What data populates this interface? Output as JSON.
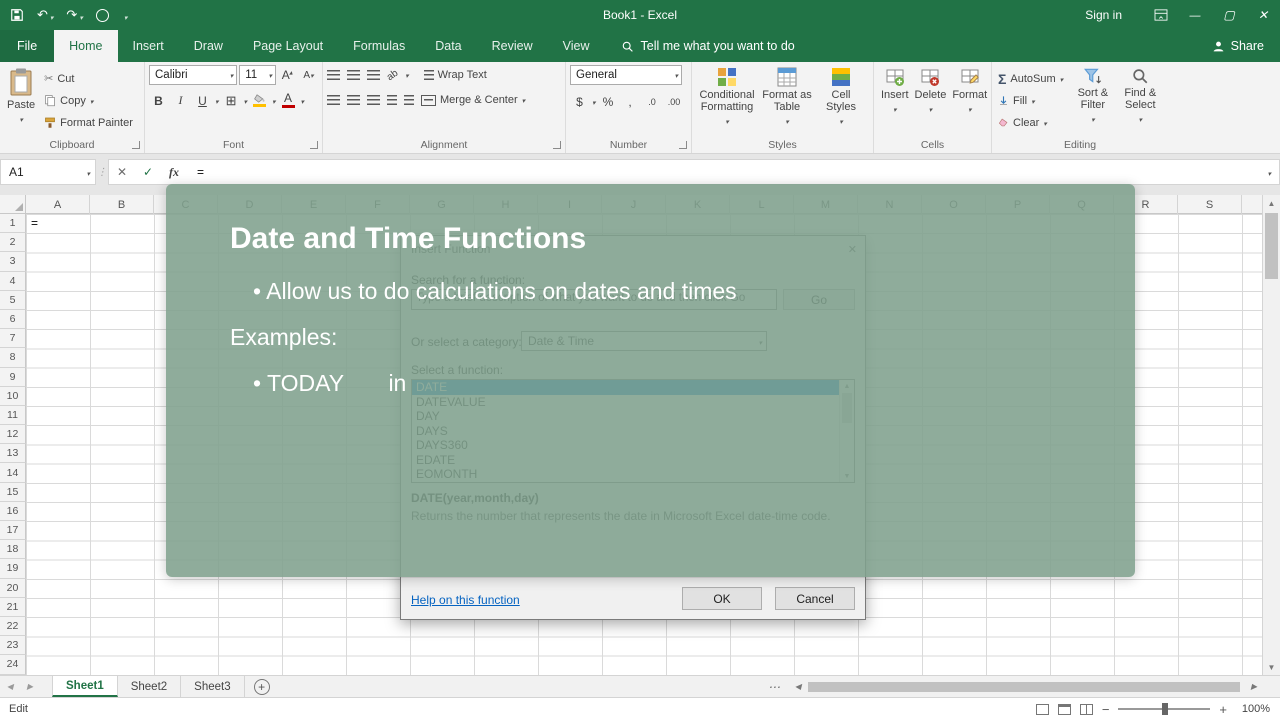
{
  "titlebar": {
    "title": "Book1 - Excel",
    "sign_in": "Sign in"
  },
  "tabs": {
    "file": "File",
    "active": "Home",
    "others": [
      "Insert",
      "Draw",
      "Page Layout",
      "Formulas",
      "Data",
      "Review",
      "View"
    ],
    "tell_me": "Tell me what you want to do",
    "share": "Share"
  },
  "ribbon": {
    "clipboard": {
      "label": "Clipboard",
      "paste": "Paste",
      "cut": "Cut",
      "copy": "Copy",
      "format_painter": "Format Painter"
    },
    "font": {
      "label": "Font",
      "name": "Calibri",
      "size": "11",
      "bold": "B",
      "italic": "I",
      "underline": "U",
      "grow": "A",
      "shrink": "A",
      "color_a": "A"
    },
    "alignment": {
      "label": "Alignment",
      "wrap_text": "Wrap Text",
      "merge_center": "Merge & Center"
    },
    "number": {
      "label": "Number",
      "format": "General",
      "currency": "$",
      "percent": "%",
      "comma": ",",
      "inc_decimal": ".0",
      "dec_decimal": ".00"
    },
    "styles": {
      "label": "Styles",
      "conditional": "Conditional Formatting",
      "format_table": "Format as Table",
      "cell_styles": "Cell Styles"
    },
    "cells": {
      "label": "Cells",
      "insert": "Insert",
      "delete": "Delete",
      "format": "Format"
    },
    "editing": {
      "label": "Editing",
      "sigma": "Σ",
      "autosum": "AutoSum",
      "fill": "Fill",
      "clear": "Clear",
      "sort_filter": "Sort & Filter",
      "find_select": "Find & Select"
    }
  },
  "formula_bar": {
    "name_box": "A1",
    "cancel": "✕",
    "enter": "✓",
    "fx": "fx",
    "formula": "="
  },
  "grid": {
    "columns": [
      "A",
      "B",
      "C",
      "D",
      "E",
      "F",
      "G",
      "H",
      "I",
      "J",
      "K",
      "L",
      "M",
      "N",
      "O",
      "P",
      "Q",
      "R",
      "S"
    ],
    "rows": [
      "1",
      "2",
      "3",
      "4",
      "5",
      "6",
      "7",
      "8",
      "9",
      "10",
      "11",
      "12",
      "13",
      "14",
      "15",
      "16",
      "17",
      "18",
      "19",
      "20",
      "21",
      "22",
      "23",
      "24"
    ],
    "active_cell_value": "="
  },
  "overlay": {
    "title": "Date and Time Functions",
    "bullet1": "• Allow us to do calculations on dates and times",
    "examples": "Examples:",
    "bullet2": "• TODAY       in"
  },
  "dialog": {
    "title": "Insert Function",
    "search_label": "Search for a function:",
    "search_hint": "Type a brief description of what you want to do and then click Go",
    "go": "Go",
    "category_label": "Or select a category:",
    "category_value": "Date & Time",
    "select_label": "Select a function:",
    "selected_function": "DATE",
    "functions": [
      "DATEVALUE",
      "DAY",
      "DAYS",
      "DAYS360",
      "EDATE",
      "EOMONTH"
    ],
    "signature": "DATE(year,month,day)",
    "description": "Returns the number that represents the date in Microsoft Excel date-time code.",
    "help_link": "Help on this function",
    "ok": "OK",
    "cancel": "Cancel"
  },
  "sheets": {
    "active": "Sheet1",
    "others": [
      "Sheet2",
      "Sheet3"
    ]
  },
  "status": {
    "mode": "Edit",
    "zoom": "100%"
  },
  "colors": {
    "excel_green": "#217346",
    "selection_blue": "#0078d7",
    "overlay_green": "rgba(127,160,141,0.88)"
  },
  "icons": {
    "save": "disk",
    "undo": "↶",
    "redo": "↷",
    "caret-down": "▾",
    "minimize": "—",
    "maximize": "▢",
    "close": "✕",
    "search": "magnifier",
    "person": "silhouette",
    "scissors": "✂",
    "sheet-left": "◀",
    "sheet-right": "▶",
    "scroll-up": "▲",
    "scroll-down": "▼",
    "new-sheet": "+",
    "ellipsis": "⋯",
    "drag-dots": "⋮"
  }
}
